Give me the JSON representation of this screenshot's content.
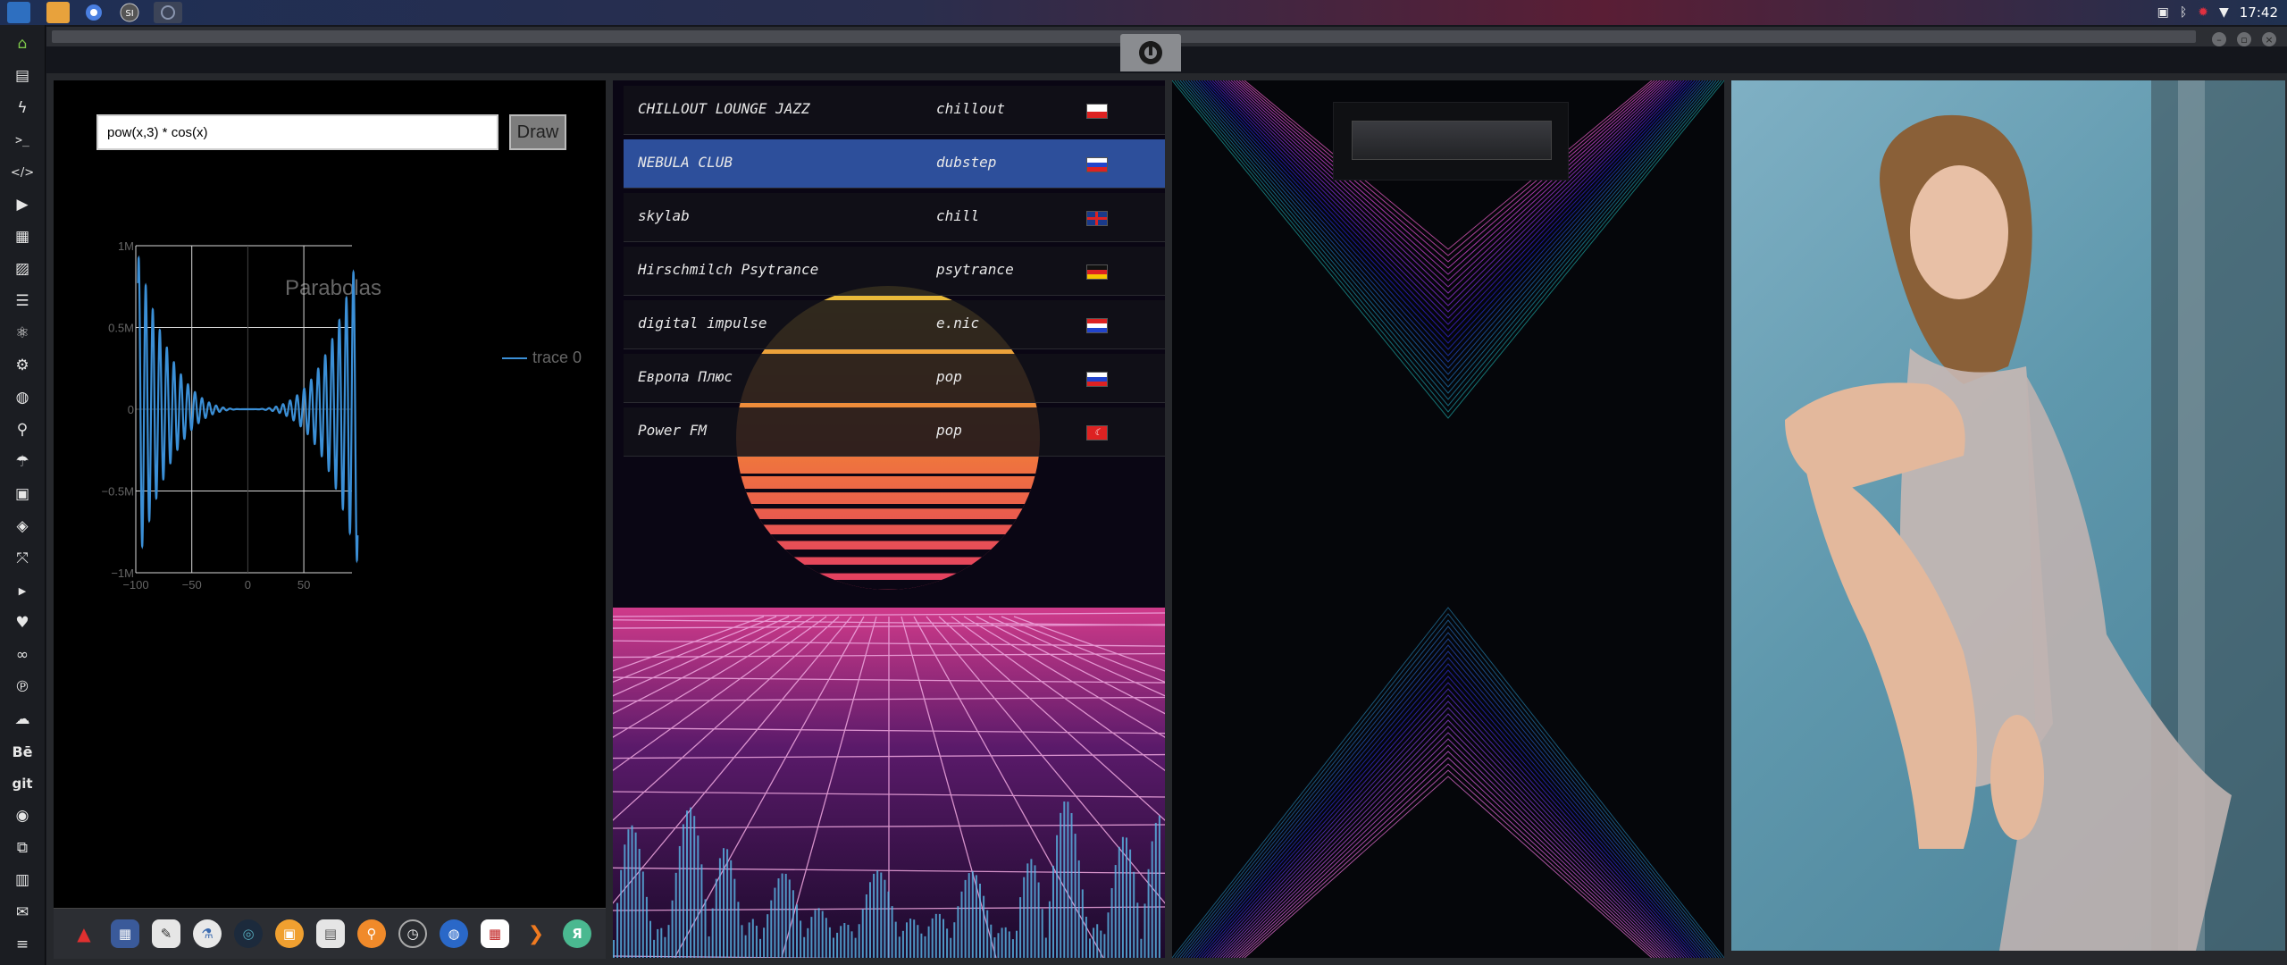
{
  "clock": "17:42",
  "calculator": {
    "formula": "pow(x,3) * cos(x)",
    "draw_label": "Draw"
  },
  "chart_data": {
    "type": "line",
    "title": "Parabolas",
    "function": "pow(x,3) * cos(x)",
    "xlabel": "",
    "ylabel": "",
    "xlim": [
      -100,
      100
    ],
    "ylim": [
      -1000000,
      1000000
    ],
    "x_ticks": [
      "−100",
      "−50",
      "0",
      "50"
    ],
    "y_ticks": [
      "−1M",
      "−0.5M",
      "0",
      "0.5M",
      "1M"
    ],
    "grid": true,
    "legend_position": "top-right",
    "series": [
      {
        "name": "trace 0",
        "color": "#3b8fd6"
      }
    ]
  },
  "stations": [
    {
      "name": "CHILLOUT LOUNGE JAZZ",
      "genre": "chillout",
      "flag": "pl",
      "active": false
    },
    {
      "name": "NEBULA CLUB",
      "genre": "dubstep",
      "flag": "ru",
      "active": true
    },
    {
      "name": "skylab",
      "genre": "chill",
      "flag": "gb",
      "active": false
    },
    {
      "name": "Hirschmilch Psytrance",
      "genre": "psytrance",
      "flag": "de",
      "active": false
    },
    {
      "name": "digital impulse",
      "genre": "e.nic",
      "flag": "hr",
      "active": false
    },
    {
      "name": "Европа Плюс",
      "genre": "pop",
      "flag": "ru",
      "active": false
    },
    {
      "name": "Power FM",
      "genre": "pop",
      "flag": "tr",
      "active": false
    }
  ],
  "left_dock": {
    "icons": [
      "home-icon",
      "document-icon",
      "lightning-icon",
      "terminal-icon",
      "code-icon",
      "play-icon",
      "files-icon",
      "image-icon",
      "news-icon",
      "atom-icon",
      "settings-icon",
      "globe-icon",
      "search-icon",
      "umbrella-icon",
      "contacts-icon",
      "git-icon",
      "fullscreen-icon",
      "youtube-icon",
      "heart-icon",
      "lastfm-icon",
      "pinterest-icon",
      "cloud-icon",
      "behance-icon",
      "git-text-icon",
      "github-icon",
      "network-icon",
      "map-icon",
      "mail-icon",
      "list-icon"
    ],
    "behance_label": "Bē",
    "git_label": "git"
  },
  "bottom_dock": {
    "icons": [
      "app-launcher-icon",
      "calculator-icon",
      "text-editor-icon",
      "lab-icon",
      "globe-3d-icon",
      "image-viewer-icon",
      "calendar-app-icon",
      "search-app-icon",
      "clock-icon",
      "browser-icon",
      "calendar-icon",
      "terminal-arrow-icon",
      "yandex-icon"
    ],
    "yandex_label": "Я"
  },
  "colors": {
    "accent": "#2d4f9b",
    "trace": "#3b8fd6"
  }
}
